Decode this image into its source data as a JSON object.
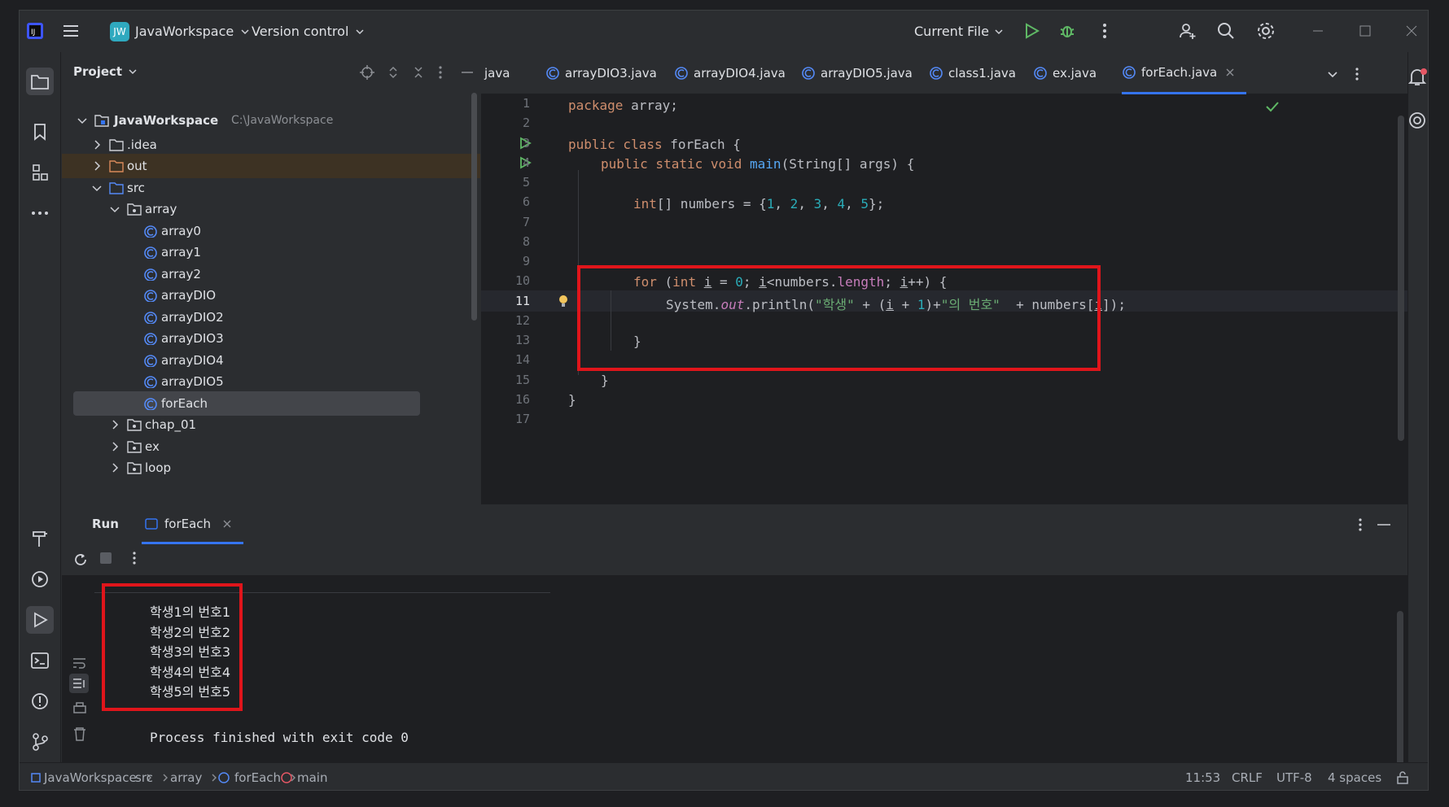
{
  "titlebar": {
    "project_badge": "JW",
    "project_name": "JavaWorkspace",
    "vcs": "Version control",
    "run_config": "Current File"
  },
  "project_panel": {
    "title": "Project",
    "root": {
      "name": "JavaWorkspace",
      "path": "C:\\JavaWorkspace"
    },
    "items": [
      ".idea",
      "out",
      "src",
      "array",
      "array0",
      "array1",
      "array2",
      "arrayDIO",
      "arrayDIO2",
      "arrayDIO3",
      "arrayDIO4",
      "arrayDIO5",
      "forEach",
      "chap_01",
      "ex",
      "loop"
    ]
  },
  "editor": {
    "tabs": [
      "java",
      "arrayDIO3.java",
      "arrayDIO4.java",
      "arrayDIO5.java",
      "class1.java",
      "ex.java",
      "forEach.java"
    ],
    "active_tab": "forEach.java",
    "line_numbers": [
      "1",
      "2",
      "3",
      "4",
      "5",
      "6",
      "7",
      "8",
      "9",
      "10",
      "11",
      "12",
      "13",
      "14",
      "15",
      "16",
      "17"
    ],
    "code": {
      "l1": [
        "package",
        " array;"
      ],
      "l3": [
        "public class",
        " forEach {"
      ],
      "l4": [
        "public static void ",
        "main",
        "(String[] args) {"
      ],
      "l6": [
        "int",
        "[] numbers = {",
        "1",
        ", ",
        "2",
        ", ",
        "3",
        ", ",
        "4",
        ", ",
        "5",
        "};"
      ],
      "l10": [
        "for",
        " (",
        "int",
        " ",
        "i",
        " = ",
        "0",
        "; ",
        "i",
        "<numbers.",
        "length",
        "; ",
        "i",
        "++) {"
      ],
      "l11": [
        "System.",
        "out",
        ".println(",
        "\"학생\"",
        " + (",
        "i",
        " + ",
        "1",
        ")+",
        "\"의 번호\"",
        "  + numbers[",
        "i",
        "]);"
      ],
      "l13": "}",
      "l15": "}",
      "l16": "}"
    }
  },
  "run_panel": {
    "title": "Run",
    "tab": "forEach",
    "output": [
      "학생1의 번호1",
      "학생2의 번호2",
      "학생3의 번호3",
      "학생4의 번호4",
      "학생5의 번호5"
    ],
    "exit": "Process finished with exit code 0"
  },
  "status": {
    "crumbs": [
      "JavaWorkspace",
      "src",
      "array",
      "forEach",
      "main"
    ],
    "position": "11:53",
    "line_sep": "CRLF",
    "encoding": "UTF-8",
    "indent": "4 spaces"
  },
  "colors": {
    "accent": "#3574f0",
    "highlight": "#e0151b",
    "run_green": "#5fb865"
  }
}
